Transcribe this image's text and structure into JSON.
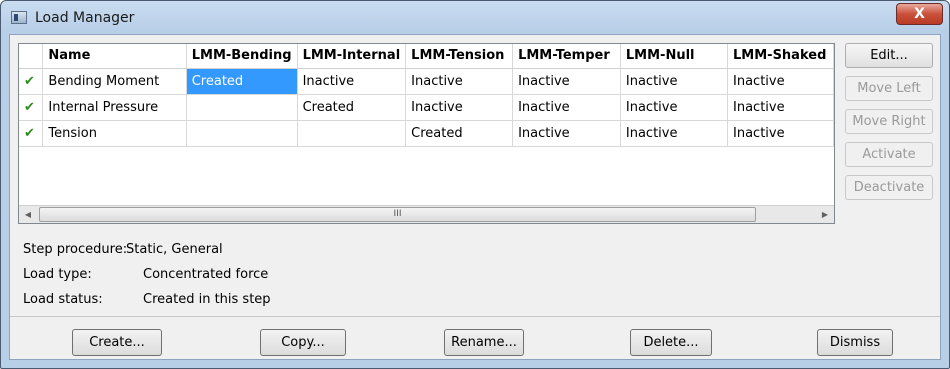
{
  "window": {
    "title": "Load Manager",
    "close_label": "X"
  },
  "grid": {
    "columns": [
      "",
      "Name",
      "LMM-Bending",
      "LMM-Internal",
      "LMM-Tension",
      "LMM-Temper",
      "LMM-Null",
      "LMM-Shaked"
    ],
    "rows": [
      {
        "check": "✔",
        "name": "Bending Moment",
        "cells": [
          "Created",
          "Inactive",
          "Inactive",
          "Inactive",
          "Inactive",
          "Inactive"
        ]
      },
      {
        "check": "✔",
        "name": "Internal Pressure",
        "cells": [
          "",
          "Created",
          "Inactive",
          "Inactive",
          "Inactive",
          "Inactive"
        ]
      },
      {
        "check": "✔",
        "name": "Tension",
        "cells": [
          "",
          "",
          "Created",
          "Inactive",
          "Inactive",
          "Inactive"
        ]
      }
    ],
    "scroll_grip": "III"
  },
  "side_buttons": {
    "edit": "Edit...",
    "move_left": "Move Left",
    "move_right": "Move Right",
    "activate": "Activate",
    "deactivate": "Deactivate"
  },
  "info": {
    "step_procedure_label": "Step procedure:",
    "step_procedure_value": "Static, General",
    "load_type_label": "Load type:",
    "load_type_value": "Concentrated force",
    "load_status_label": "Load status:",
    "load_status_value": "Created in this step"
  },
  "bottom_buttons": {
    "create": "Create...",
    "copy": "Copy...",
    "rename": "Rename...",
    "delete": "Delete...",
    "dismiss": "Dismiss"
  }
}
